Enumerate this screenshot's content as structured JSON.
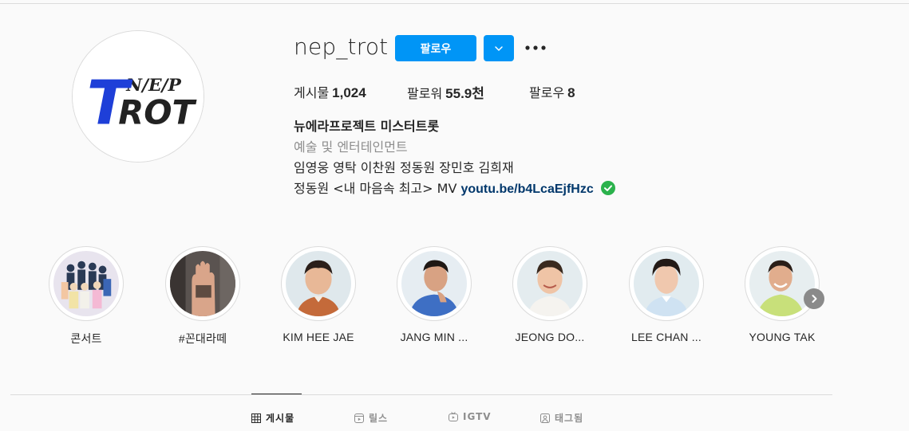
{
  "profile": {
    "username": "nep_trot",
    "avatar_logo": {
      "small": "N/E/P",
      "big_t": "T",
      "big_rest": "ROT"
    },
    "follow_label": "팔로우",
    "stats": {
      "posts_label": "게시물",
      "posts_value": "1,024",
      "followers_label": "팔로워",
      "followers_value": "55.9천",
      "following_label": "팔로우",
      "following_value": "8"
    },
    "bio": {
      "name": "뉴에라프로젝트 미스터트롯",
      "category": "예술 및 엔터테인먼트",
      "members": "임영웅 영탁 이찬원 정동원 장민호 김희재",
      "mv_text": "정동원 <내 마음속 최고> MV",
      "link": "youtu.be/b4LcaEjfHzc"
    }
  },
  "highlights": [
    {
      "label": "콘서트",
      "bg": "#e8e4ee"
    },
    {
      "label": "#꼰대라떼",
      "bg": "#5a5350"
    },
    {
      "label": "KIM HEE JAE",
      "bg": "#dfe8ec"
    },
    {
      "label": "JANG MIN ...",
      "bg": "#e6edf2"
    },
    {
      "label": "JEONG DO...",
      "bg": "#e4ecef"
    },
    {
      "label": "LEE CHAN ...",
      "bg": "#e1ebef"
    },
    {
      "label": "YOUNG TAK",
      "bg": "#e7eef0"
    }
  ],
  "tabs": [
    {
      "label": "게시물",
      "icon": "grid-icon",
      "active": true
    },
    {
      "label": "릴스",
      "icon": "reels-icon",
      "active": false
    },
    {
      "label": "IGTV",
      "icon": "igtv-icon",
      "active": false
    },
    {
      "label": "태그됨",
      "icon": "tagged-icon",
      "active": false
    }
  ],
  "colors": {
    "accent": "#0095f6",
    "link": "#00376b",
    "verified": "#2bb24c",
    "logo_blue": "#1e3fd8"
  }
}
